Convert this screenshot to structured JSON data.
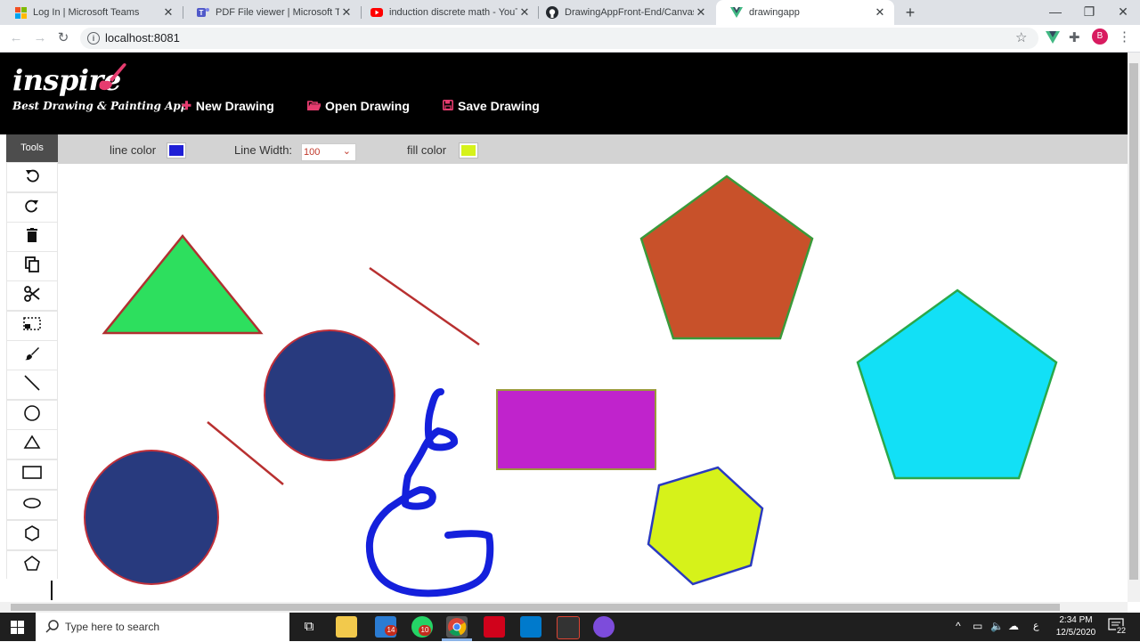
{
  "browser": {
    "tabs": [
      {
        "title": "Log In | Microsoft Teams",
        "icon": "microsoft-icon"
      },
      {
        "title": "PDF File viewer | Microsoft Teams",
        "icon": "teams-icon"
      },
      {
        "title": "induction discrete math - YouTube",
        "icon": "youtube-icon"
      },
      {
        "title": "DrawingAppFront-End/Canvas.vue",
        "icon": "github-icon"
      },
      {
        "title": "drawingapp",
        "icon": "vue-icon",
        "active": true
      }
    ],
    "url": "localhost:8081",
    "profile_initial": "B"
  },
  "app": {
    "logo": "inspire",
    "tagline": "Best Drawing & Painting App",
    "menu": {
      "new": "New Drawing",
      "open": "Open Drawing",
      "save": "Save Drawing"
    },
    "options": {
      "line_color_label": "line color",
      "line_color": "#1f1fd6",
      "line_width_label": "Line Width:",
      "line_width_value": "100",
      "fill_color_label": "fill color",
      "fill_color": "#d6f21a"
    },
    "tools_title": "Tools",
    "tools": [
      "undo-icon",
      "redo-icon",
      "delete-icon",
      "copy-icon",
      "cut-icon",
      "select-icon",
      "brush-icon",
      "line-icon",
      "circle-icon",
      "triangle-icon",
      "rectangle-icon",
      "ellipse-icon",
      "hexagon-icon",
      "pentagon-icon"
    ]
  },
  "canvas": {
    "colors": {
      "triangle_fill": "#2ddf5e",
      "triangle_stroke": "#b03030",
      "circle_fill": "#283a7e",
      "circle_stroke": "#c0303a",
      "line_stroke": "#b83030",
      "pentagon1_fill": "#c8512a",
      "pentagon1_stroke": "#3a9a3a",
      "pentagon2_fill": "#12e0f6",
      "pentagon2_stroke": "#2aa84a",
      "rect_fill": "#c023cc",
      "rect_stroke": "#9a9a3a",
      "hexagon_fill": "#d6f21a",
      "hexagon_stroke": "#2a3ac0",
      "freehand_stroke": "#1420dc"
    }
  },
  "taskbar": {
    "search_placeholder": "Type here to search",
    "time": "2:34 PM",
    "date": "12/5/2020",
    "notification_count": "22",
    "mail_badge": "14",
    "whatsapp_badge": "10"
  }
}
